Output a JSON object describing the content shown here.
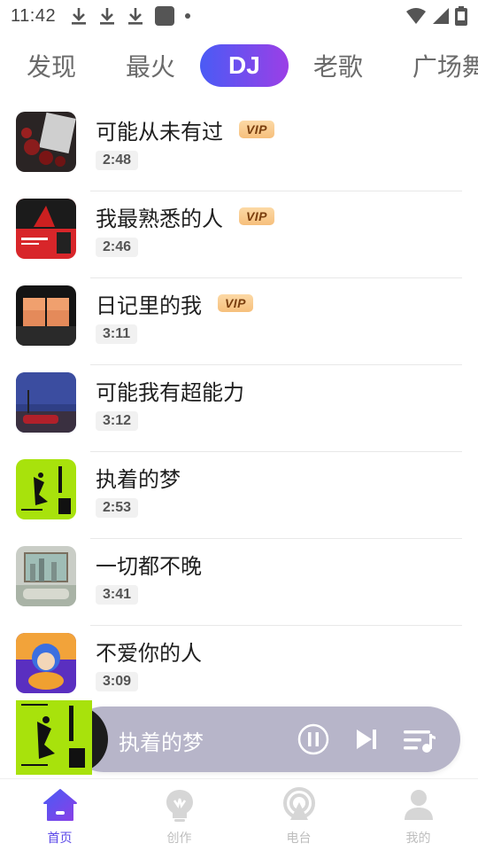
{
  "status_bar": {
    "time": "11:42",
    "icons": [
      "download-icon",
      "download-icon",
      "download-icon",
      "app-icon",
      "dot",
      "wifi-icon",
      "signal-icon",
      "battery-icon"
    ]
  },
  "tabs": [
    {
      "label": "发现",
      "active": false
    },
    {
      "label": "最火",
      "active": false
    },
    {
      "label": "DJ",
      "active": true
    },
    {
      "label": "老歌",
      "active": false
    },
    {
      "label": "广场舞",
      "active": false
    }
  ],
  "songs": [
    {
      "title": "可能从未有过",
      "vip": true,
      "duration": "2:48",
      "cover": "dark-roses"
    },
    {
      "title": "我最熟悉的人",
      "vip": true,
      "duration": "2:46",
      "cover": "red-album"
    },
    {
      "title": "日记里的我",
      "vip": true,
      "duration": "3:11",
      "cover": "sunset-window"
    },
    {
      "title": "可能我有超能力",
      "vip": false,
      "duration": "3:12",
      "cover": "blue-dusk"
    },
    {
      "title": "执着的梦",
      "vip": false,
      "duration": "2:53",
      "cover": "lime-album"
    },
    {
      "title": "一切都不晚",
      "vip": false,
      "duration": "3:41",
      "cover": "city-painting"
    },
    {
      "title": "不爱你的人",
      "vip": false,
      "duration": "3:09",
      "cover": "blue-girl"
    }
  ],
  "vip_label": "VIP",
  "player": {
    "title": "执着的梦",
    "state": "playing",
    "cover": "lime-album"
  },
  "bottom_nav": [
    {
      "label": "首页",
      "icon": "home-icon",
      "active": true
    },
    {
      "label": "创作",
      "icon": "create-icon",
      "active": false
    },
    {
      "label": "电台",
      "icon": "radio-icon",
      "active": false
    },
    {
      "label": "我的",
      "icon": "profile-icon",
      "active": false
    }
  ],
  "colors": {
    "accent_start": "#4a5bf5",
    "accent_end": "#9b3fe6",
    "nav_active": "#5b48e8",
    "player_bg": "#b7b5c9",
    "vip_bg": "#f8c98b"
  }
}
